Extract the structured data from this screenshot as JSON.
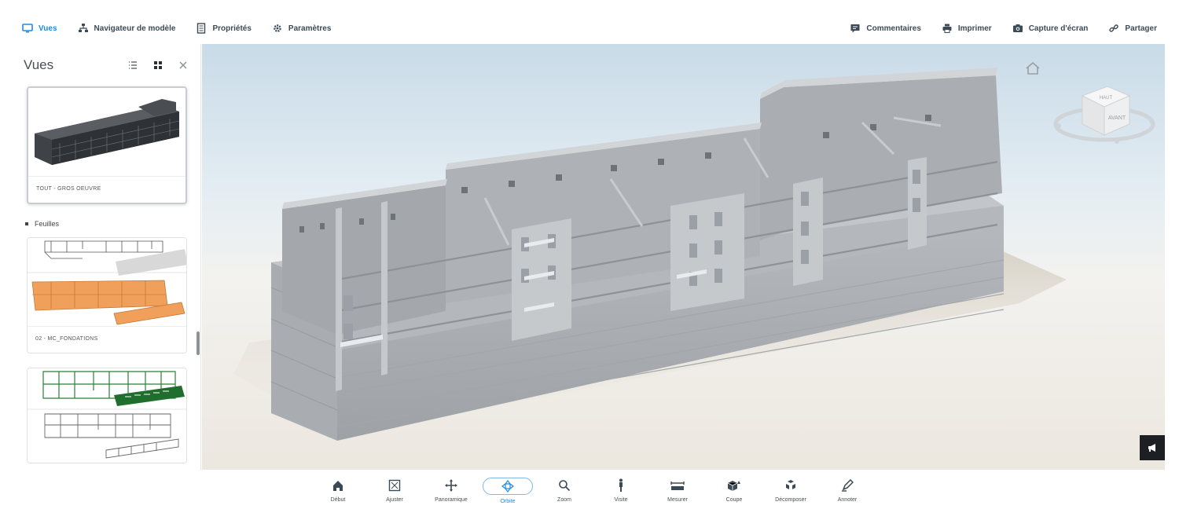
{
  "topbar": {
    "left_items": [
      {
        "label": "Vues",
        "icon": "monitor-icon",
        "active": true
      },
      {
        "label": "Navigateur de modèle",
        "icon": "hierarchy-icon",
        "active": false
      },
      {
        "label": "Propriétés",
        "icon": "document-icon",
        "active": false
      },
      {
        "label": "Paramètres",
        "icon": "gear-icon",
        "active": false
      }
    ],
    "right_items": [
      {
        "label": "Commentaires",
        "icon": "comment-icon"
      },
      {
        "label": "Imprimer",
        "icon": "printer-icon"
      },
      {
        "label": "Capture d'écran",
        "icon": "camera-icon"
      },
      {
        "label": "Partager",
        "icon": "link-icon"
      }
    ],
    "accent_color": "#1f8be0"
  },
  "panel": {
    "title": "Vues",
    "views": [
      {
        "label": "TOUT - GROS OEUVRE",
        "selected": true
      }
    ],
    "section_title": "Feuilles",
    "sheets": [
      {
        "label": "02 - MC_FONDATIONS"
      },
      {
        "label": ""
      }
    ]
  },
  "viewcube": {
    "top_face": "HAUT",
    "front_face": "AVANT"
  },
  "bottombar": {
    "tools": [
      {
        "label": "Début",
        "icon": "home-icon"
      },
      {
        "label": "Ajuster",
        "icon": "fit-icon"
      },
      {
        "label": "Panoramique",
        "icon": "pan-icon"
      },
      {
        "label": "Orbite",
        "icon": "orbit-icon",
        "active": true
      },
      {
        "label": "Zoom",
        "icon": "zoom-icon"
      },
      {
        "label": "Visite",
        "icon": "walk-icon"
      },
      {
        "label": "Mesurer",
        "icon": "measure-icon"
      },
      {
        "label": "Coupe",
        "icon": "section-icon"
      },
      {
        "label": "Décomposer",
        "icon": "explode-icon"
      },
      {
        "label": "Annoter",
        "icon": "annotate-icon"
      }
    ]
  }
}
